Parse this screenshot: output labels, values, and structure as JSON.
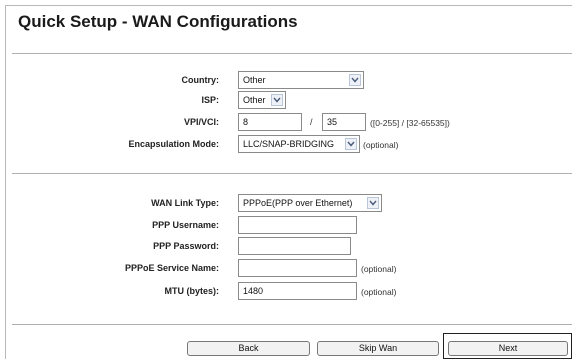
{
  "page": {
    "title": "Quick Setup - WAN Configurations"
  },
  "dsl": {
    "country_label": "Country:",
    "country_value": "Other",
    "isp_label": "ISP:",
    "isp_value": "Other",
    "vpivci_label": "VPI/VCI:",
    "vpi_value": "8",
    "vci_sep": "/",
    "vci_value": "35",
    "vpivci_hint": "([0-255] / [32-65535])",
    "encap_label": "Encapsulation Mode:",
    "encap_value": "LLC/SNAP-BRIDGING",
    "encap_note": "(optional)"
  },
  "wan": {
    "link_type_label": "WAN Link Type:",
    "link_type_value": "PPPoE(PPP over Ethernet)",
    "username_label": "PPP Username:",
    "username_value": "",
    "password_label": "PPP Password:",
    "password_value": "",
    "service_label": "PPPoE Service Name:",
    "service_value": "",
    "service_note": "(optional)",
    "mtu_label": "MTU (bytes):",
    "mtu_value": "1480",
    "mtu_note": "(optional)"
  },
  "buttons": {
    "back": "Back",
    "skip": "Skip Wan",
    "next": "Next"
  },
  "icons": {
    "dropdown": "chevron-down-icon"
  }
}
